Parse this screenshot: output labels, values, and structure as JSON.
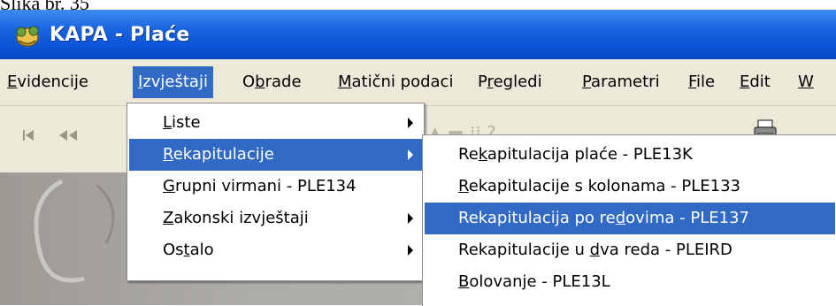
{
  "caption": "Slika br. 35",
  "window": {
    "title": "KAPA - Plaće"
  },
  "menubar": {
    "items": [
      {
        "label": "Evidencije"
      },
      {
        "label": "Izvještaji"
      },
      {
        "label": "Obrade"
      },
      {
        "label": "Matični podaci"
      },
      {
        "label": "Pregledi"
      },
      {
        "label": "Parametri"
      },
      {
        "label": "File"
      },
      {
        "label": "Edit"
      },
      {
        "label": "W"
      }
    ]
  },
  "izvjestaji_menu": {
    "items": [
      {
        "label": "Liste",
        "submenu": true
      },
      {
        "label": "Rekapitulacije",
        "submenu": true
      },
      {
        "label": "Grupni virmani - PLE134",
        "submenu": false
      },
      {
        "label": "Zakonski izvještaji",
        "submenu": true
      },
      {
        "label": "Ostalo",
        "submenu": true
      }
    ],
    "selected": "Rekapitulacije"
  },
  "rekapitulacije_menu": {
    "items": [
      {
        "label": "Rekapitulacija plaće - PLE13K"
      },
      {
        "label": "Rekapitulacije s kolonama - PLE133"
      },
      {
        "label": "Rekapitulacija po redovima - PLE137"
      },
      {
        "label": "Rekapitulacije u dva reda - PLEIRD"
      },
      {
        "label": "Bolovanje - PLE13L"
      }
    ],
    "selected": "Rekapitulacija po redovima - PLE137"
  },
  "toolbar": {
    "icons": [
      "first-record-icon",
      "previous-record-icon",
      "help-icon",
      "printer-icon"
    ]
  },
  "colors": {
    "titlebar": "#0a55d6",
    "menubar": "#ece9d8",
    "highlight": "#316ac5"
  }
}
